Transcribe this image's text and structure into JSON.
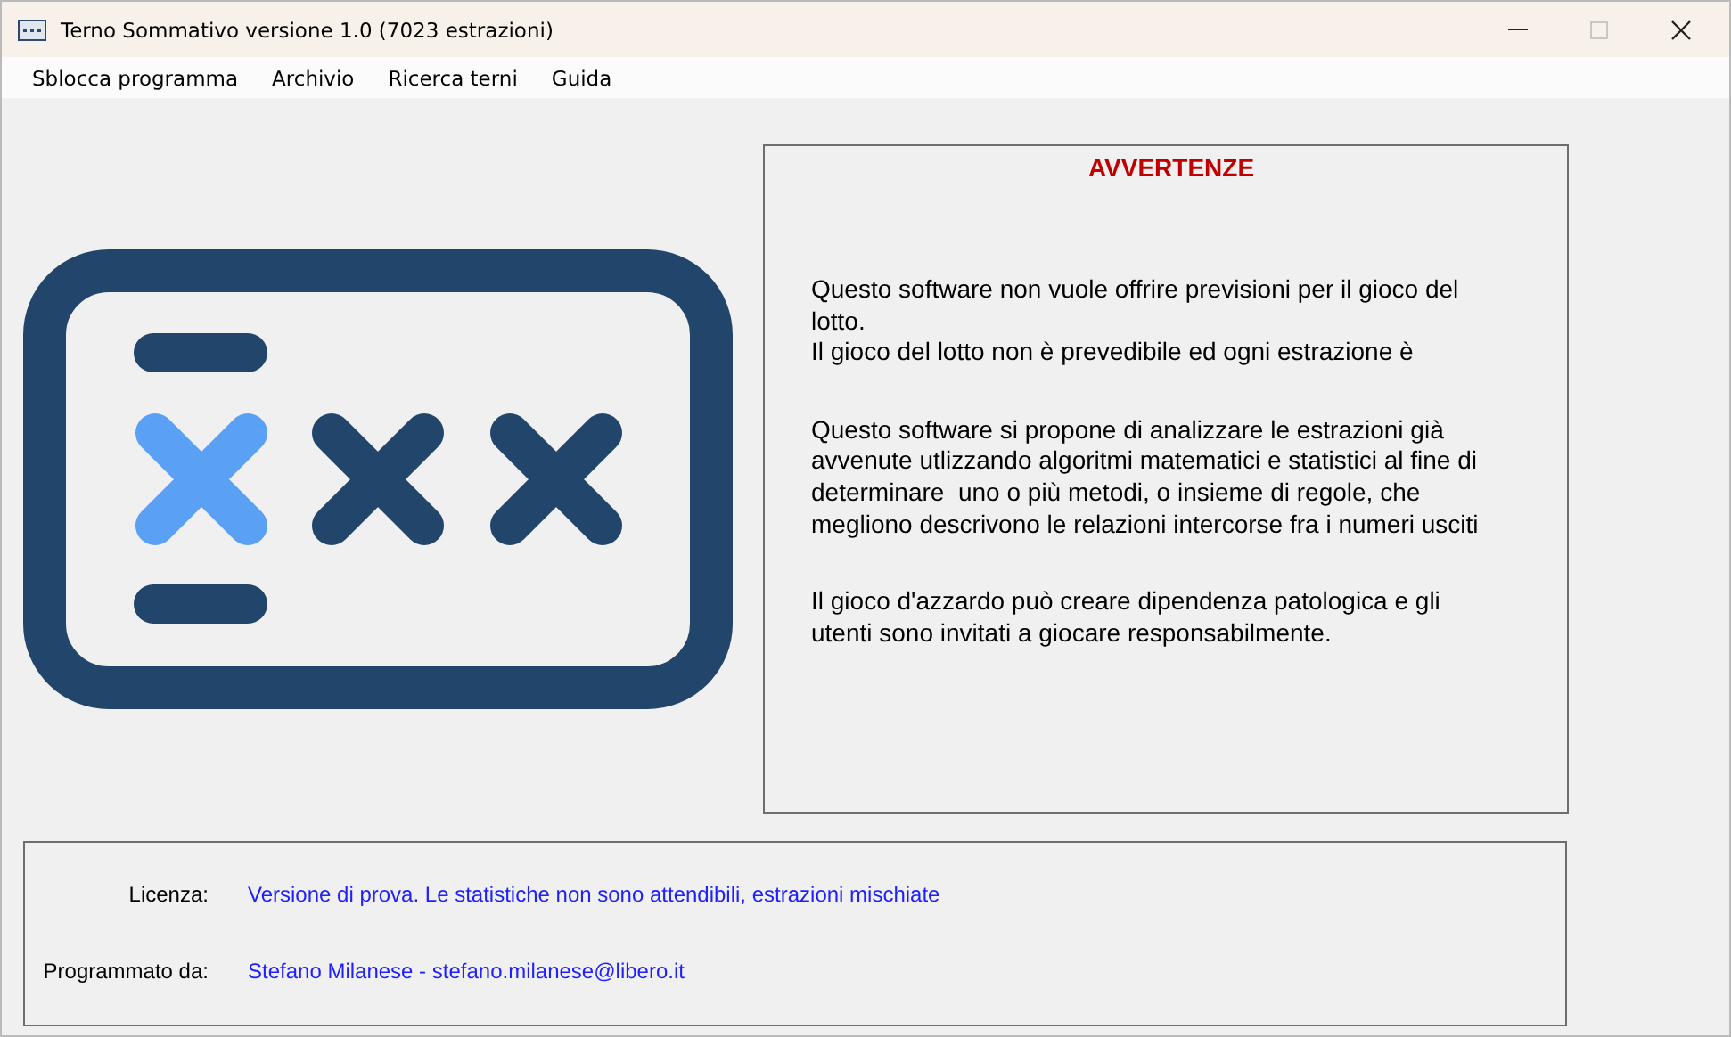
{
  "window": {
    "title": "Terno Sommativo versione 1.0 (7023 estrazioni)",
    "maximize_disabled": true
  },
  "menu": [
    "Sblocca programma",
    "Archivio",
    "Ricerca terni",
    "Guida"
  ],
  "warnings": {
    "title": "AVVERTENZE",
    "paragraphs": [
      {
        "lines": [
          "Questo software non vuole offrire previsioni per il gioco del lotto.",
          "Il gioco del lotto non è prevedibile ed ogni estrazione è"
        ]
      },
      {
        "lines": [
          "Questo software si propone di analizzare le estrazioni già avvenute utlizzando algoritmi matematici e statistici al fine di determinare  uno o più metodi, o insieme di regole, che megliono descrivono le relazioni intercorse fra i numeri usciti"
        ]
      },
      {
        "lines": [
          "Il gioco d'azzardo può creare dipendenza patologica e gli utenti sono invitati a giocare responsabilmente."
        ]
      }
    ]
  },
  "info": [
    {
      "label": "Licenza:",
      "value": "Versione di prova. Le statistiche non sono attendibili, estrazioni mischiate"
    },
    {
      "label": "Programmato da:",
      "value": "Stefano Milanese - stefano.milanese@libero.it"
    }
  ]
}
